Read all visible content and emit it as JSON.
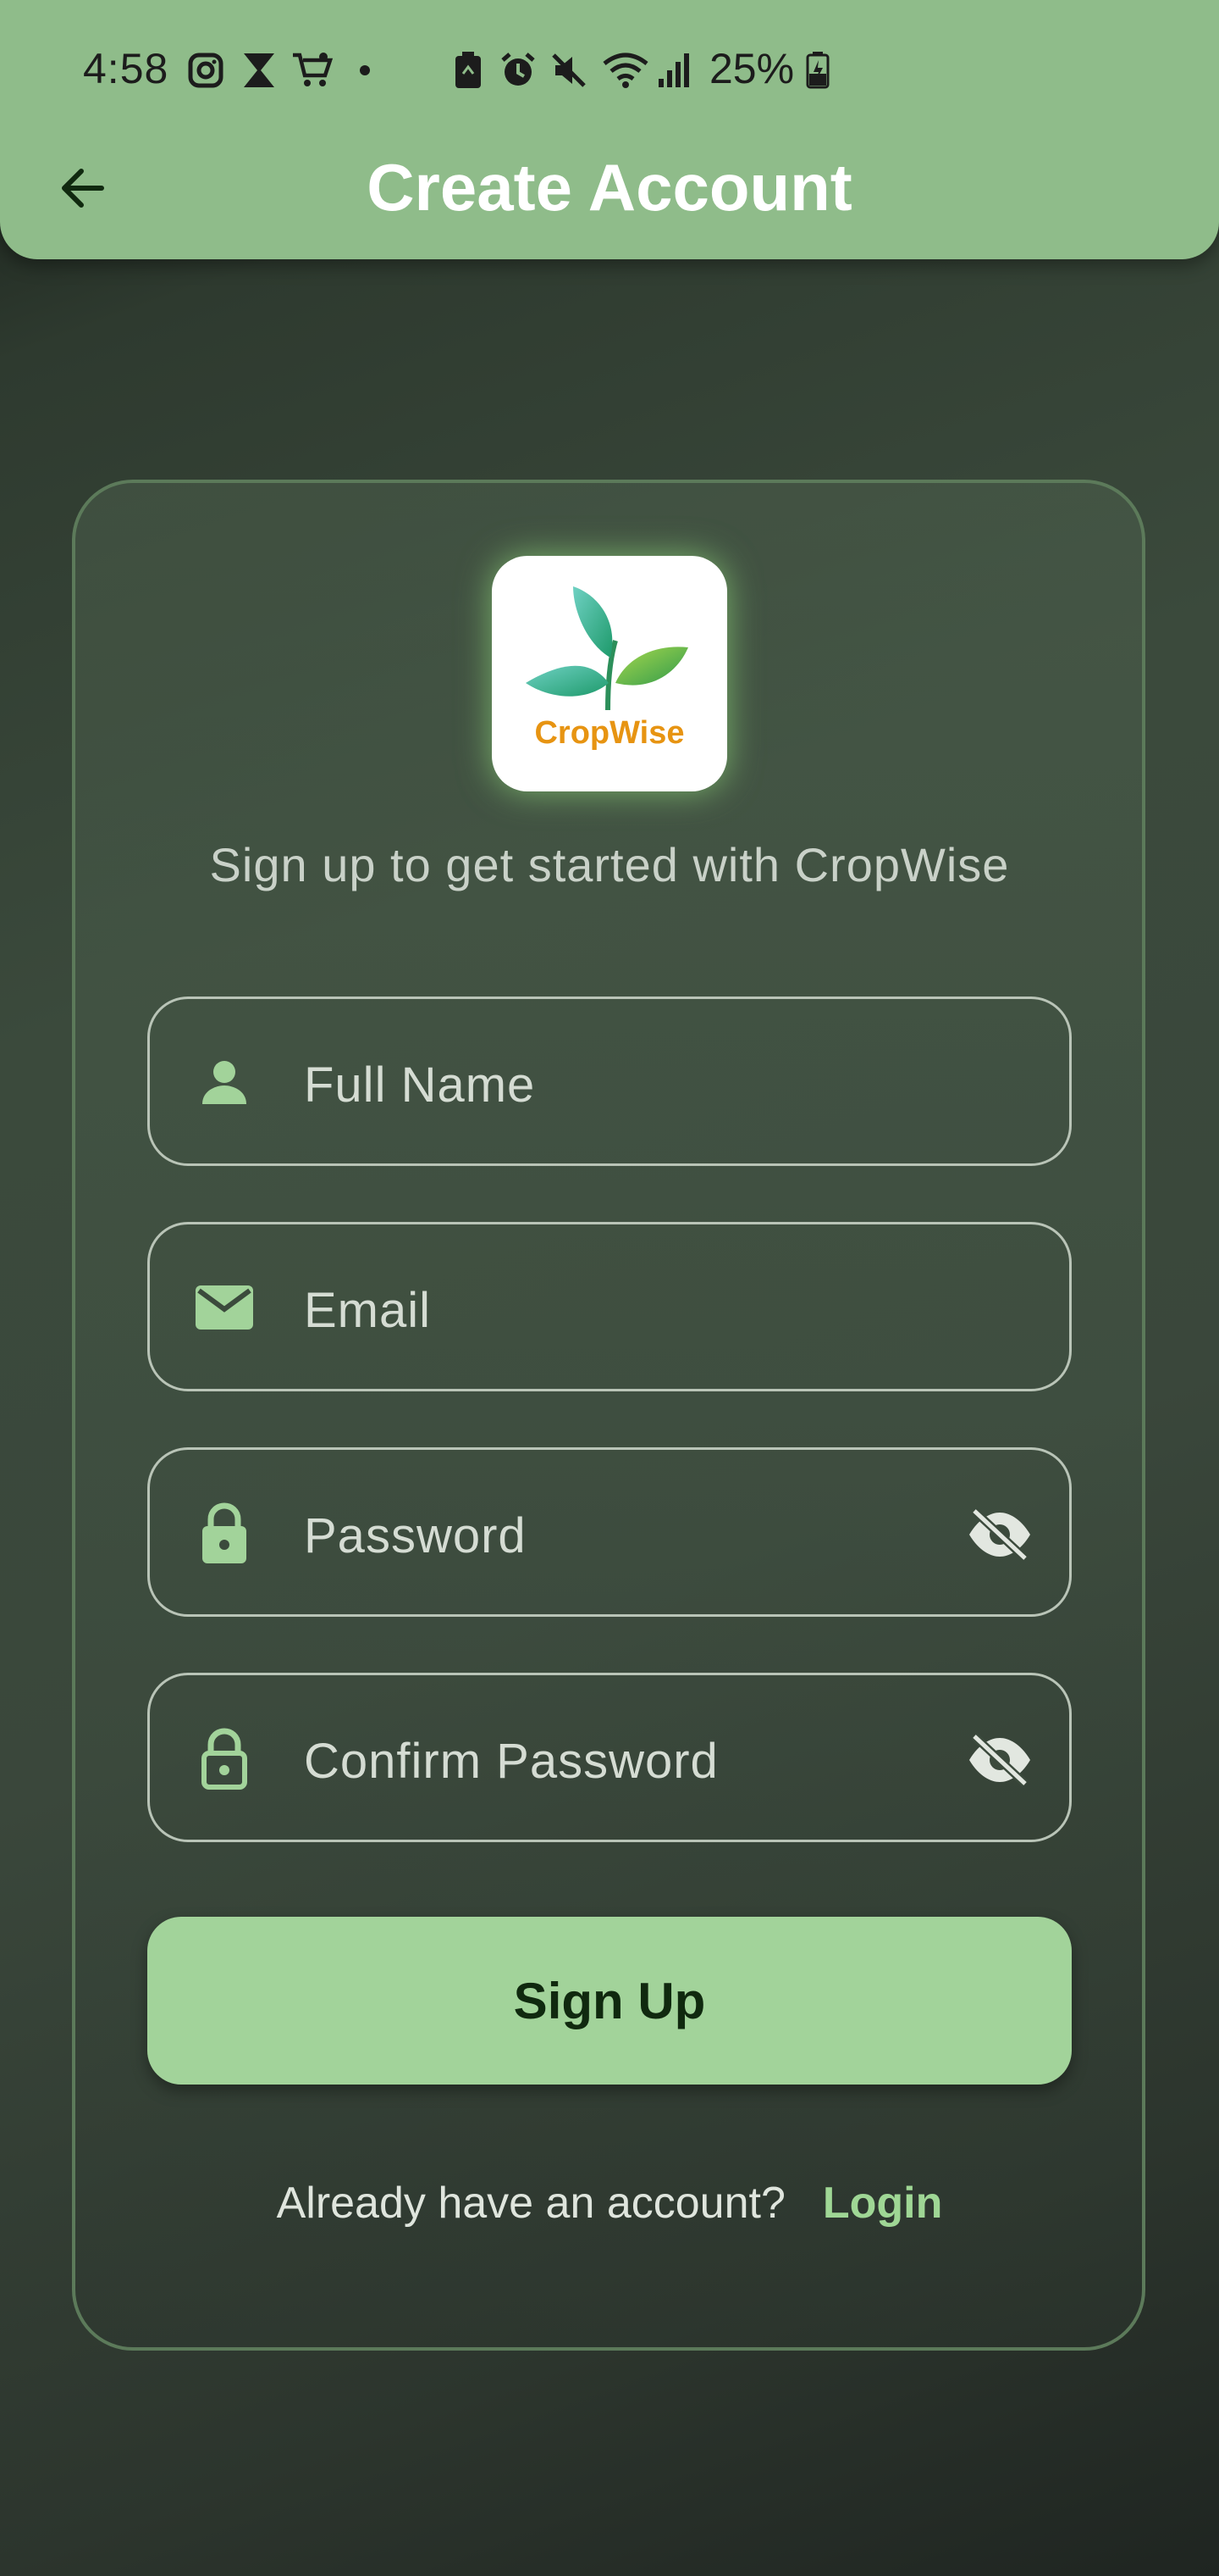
{
  "status_bar": {
    "time": "4:58",
    "battery_percent": "25%",
    "icons": [
      "instagram-icon",
      "hourglass-icon",
      "shopping-cart-icon",
      "dot-icon",
      "battery-saver-icon",
      "alarm-icon",
      "mute-icon",
      "wifi-icon",
      "signal-icon",
      "battery-charging-icon"
    ]
  },
  "app_bar": {
    "title": "Create Account",
    "back_icon": "arrow-left-icon"
  },
  "logo": {
    "text": "CropWise",
    "icon": "leaf-sprout-icon"
  },
  "subtitle": "Sign up to get started with CropWise",
  "form": {
    "full_name": {
      "placeholder": "Full Name",
      "value": "",
      "icon": "person-icon"
    },
    "email": {
      "placeholder": "Email",
      "value": "",
      "icon": "mail-icon"
    },
    "password": {
      "placeholder": "Password",
      "value": "",
      "icon": "lock-icon",
      "toggle_icon": "eye-off-icon"
    },
    "confirm_password": {
      "placeholder": "Confirm Password",
      "value": "",
      "icon": "lock-outline-icon",
      "toggle_icon": "eye-off-icon"
    }
  },
  "signup_button": "Sign Up",
  "login_prompt": {
    "question": "Already have an account?",
    "link": "Login"
  },
  "colors": {
    "app_bar": "#8fbc8a",
    "accent": "#a2d39a",
    "icon": "#a2d39a",
    "link": "#9fd795",
    "button_text": "#10290f"
  }
}
